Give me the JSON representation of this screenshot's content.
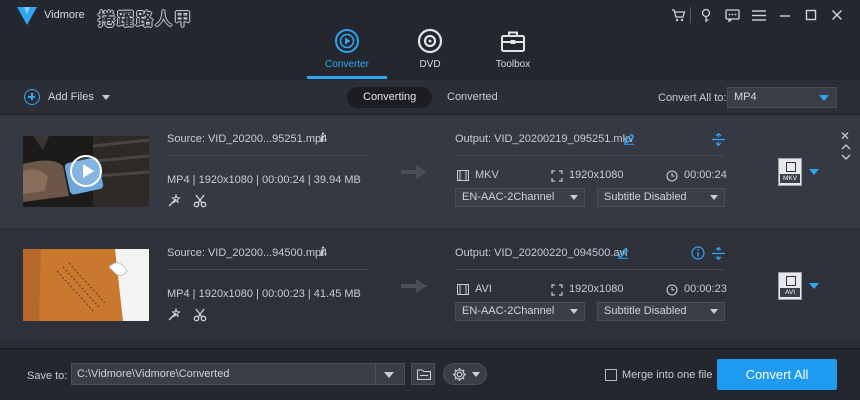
{
  "app": {
    "name": "Vidmore",
    "watermark": "捲躍路人甲",
    "accent_color": "#2fa6f2"
  },
  "window_controls": [
    "cart-icon",
    "key-icon",
    "feedback-icon",
    "menu-icon",
    "minimize-icon",
    "maximize-icon",
    "close-icon"
  ],
  "main_tabs": [
    {
      "label": "Converter",
      "icon": "converter-icon",
      "active": true
    },
    {
      "label": "DVD",
      "icon": "dvd-icon",
      "active": false
    },
    {
      "label": "Toolbox",
      "icon": "toolbox-icon",
      "active": false
    }
  ],
  "toolbar": {
    "add_files": "Add Files",
    "segments": [
      "Converting",
      "Converted"
    ],
    "active_segment": "Converting",
    "convert_all_to_label": "Convert All to:",
    "convert_all_to_value": "MP4"
  },
  "files": [
    {
      "source": "Source: VID_20200...95251.mp4",
      "meta": "MP4 | 1920x1080 | 00:00:24 | 39.94 MB",
      "output": "Output: VID_20200219_095251.mkv",
      "out_format": "MKV",
      "out_resolution": "1920x1080",
      "out_duration": "00:00:24",
      "audio": "EN-AAC-2Channel",
      "subtitle": "Subtitle Disabled",
      "badge": "MKV"
    },
    {
      "source": "Source: VID_20200...94500.mp4",
      "meta": "MP4 | 1920x1080 | 00:00:23 | 41.45 MB",
      "output": "Output: VID_20200220_094500.avi",
      "out_format": "AVI",
      "out_resolution": "1920x1080",
      "out_duration": "00:00:23",
      "audio": "EN-AAC-2Channel",
      "subtitle": "Subtitle Disabled",
      "badge": "AVI"
    }
  ],
  "bottom": {
    "save_to_label": "Save to:",
    "save_path": "C:\\Vidmore\\Vidmore\\Converted",
    "merge_label": "Merge into one file",
    "convert_all_label": "Convert All"
  }
}
